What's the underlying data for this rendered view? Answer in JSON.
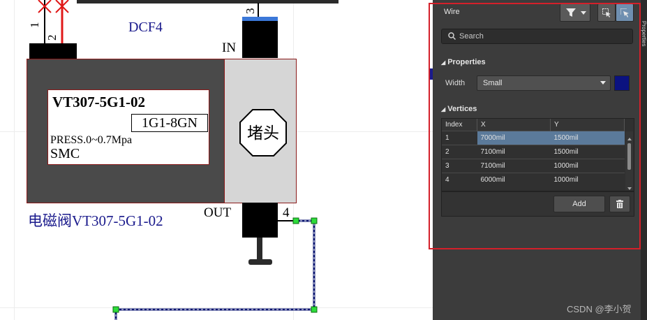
{
  "schematic": {
    "net_label": "DCF4",
    "pin_left_1": "1",
    "pin_left_2": "2",
    "pin_top": "3",
    "pin_out_num": "4",
    "port_in": "IN",
    "port_out": "OUT",
    "part_number": "VT307-5G1-02",
    "sub_model": "1G1-8GN",
    "pressure": "PRESS.0~0.7Mpa",
    "brand": "SMC",
    "plug_label": "堵头",
    "component_name": "电磁阀VT307-5G1-02"
  },
  "panel": {
    "title": "Wire",
    "side_tab": "Properties",
    "search_placeholder": "Search",
    "properties_label": "Properties",
    "width_label": "Width",
    "width_value": "Small",
    "width_color": "#0b1280",
    "vertices_label": "Vertices",
    "columns": [
      "Index",
      "X",
      "Y"
    ],
    "rows": [
      {
        "index": "1",
        "x": "7000mil",
        "y": "1500mil"
      },
      {
        "index": "2",
        "x": "7100mil",
        "y": "1500mil"
      },
      {
        "index": "3",
        "x": "7100mil",
        "y": "1000mil"
      },
      {
        "index": "4",
        "x": "6000mil",
        "y": "1000mil"
      }
    ],
    "add_label": "Add"
  },
  "watermark": "CSDN @李小贺"
}
